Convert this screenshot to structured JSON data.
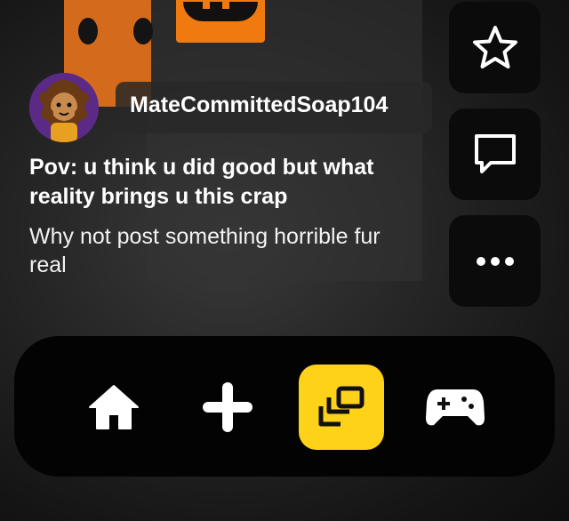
{
  "post": {
    "username": "MateCommittedSoap104",
    "title": "Pov: u think u did good but what reality brings u this crap",
    "body": "Why not post something horrible fur real"
  },
  "side_actions": [
    {
      "name": "favorite",
      "icon": "star-icon"
    },
    {
      "name": "comments",
      "icon": "comment-icon"
    },
    {
      "name": "more",
      "icon": "more-icon"
    }
  ],
  "nav": {
    "items": [
      {
        "name": "home",
        "icon": "home-icon",
        "active": false
      },
      {
        "name": "create",
        "icon": "plus-icon",
        "active": false
      },
      {
        "name": "feed",
        "icon": "stacked-cards-icon",
        "active": true
      },
      {
        "name": "games",
        "icon": "gamepad-icon",
        "active": false
      }
    ],
    "active_color": "#ffd21a"
  }
}
